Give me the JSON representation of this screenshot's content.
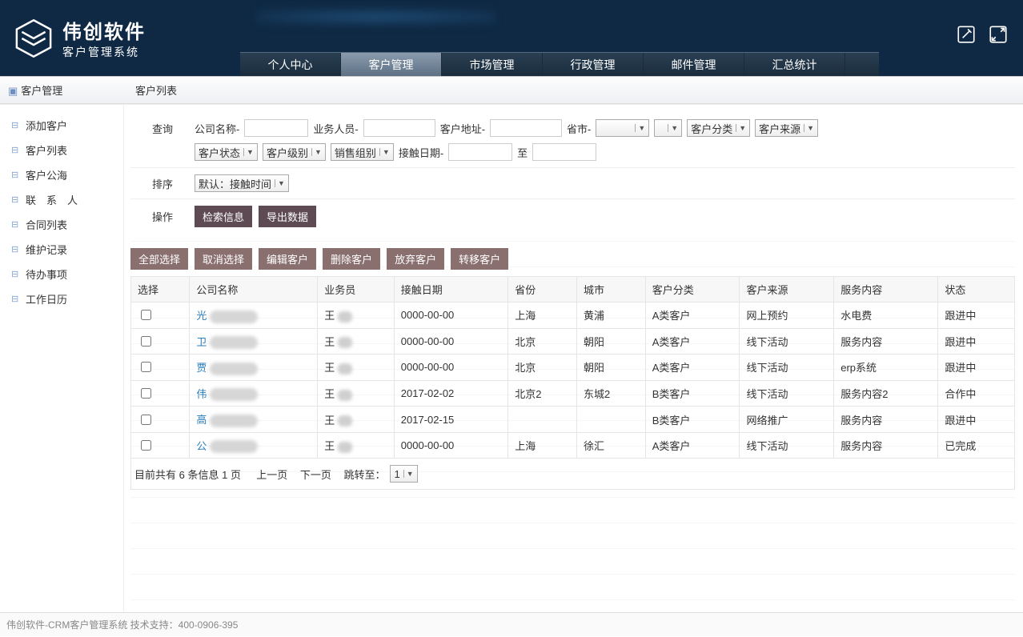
{
  "brand": {
    "name": "伟创软件",
    "sub": "客户管理系统"
  },
  "nav": [
    "个人中心",
    "客户管理",
    "市场管理",
    "行政管理",
    "邮件管理",
    "汇总统计"
  ],
  "nav_active_index": 1,
  "subheader": {
    "left": "客户管理",
    "title": "客户列表"
  },
  "sidebar": [
    "添加客户",
    "客户列表",
    "客户公海",
    "联　系　人",
    "合同列表",
    "维护记录",
    "待办事项",
    "工作日历"
  ],
  "search": {
    "section_label": "查询",
    "company_label": "公司名称-",
    "sales_label": "业务人员-",
    "address_label": "客户地址-",
    "province_label": "省市-",
    "category_label": "客户分类",
    "source_label": "客户来源",
    "status_label": "客户状态",
    "level_label": "客户级别",
    "salesgroup_label": "销售组别",
    "contact_date_label": "接触日期-",
    "to": "至"
  },
  "sort": {
    "label": "排序",
    "default": "默认：接触时间"
  },
  "ops": {
    "label": "操作",
    "search_btn": "检索信息",
    "export_btn": "导出数据"
  },
  "bulk_buttons": [
    "全部选择",
    "取消选择",
    "编辑客户",
    "删除客户",
    "放弃客户",
    "转移客户"
  ],
  "table": {
    "headers": [
      "选择",
      "公司名称",
      "业务员",
      "接触日期",
      "省份",
      "城市",
      "客户分类",
      "客户来源",
      "服务内容",
      "状态"
    ],
    "rows": [
      {
        "company": "光",
        "sales": "王",
        "date": "0000-00-00",
        "prov": "上海",
        "city": "黄浦",
        "cat": "A类客户",
        "src": "网上预约",
        "svc": "水电费",
        "status": "跟进中"
      },
      {
        "company": "卫",
        "sales": "王",
        "date": "0000-00-00",
        "prov": "北京",
        "city": "朝阳",
        "cat": "A类客户",
        "src": "线下活动",
        "svc": "服务内容",
        "status": "跟进中"
      },
      {
        "company": "贾",
        "sales": "王",
        "date": "0000-00-00",
        "prov": "北京",
        "city": "朝阳",
        "cat": "A类客户",
        "src": "线下活动",
        "svc": "erp系统",
        "status": "跟进中"
      },
      {
        "company": "伟",
        "sales": "王",
        "date": "2017-02-02",
        "prov": "北京2",
        "city": "东城2",
        "cat": "B类客户",
        "src": "线下活动",
        "svc": "服务内容2",
        "status": "合作中"
      },
      {
        "company": "高",
        "sales": "王",
        "date": "2017-02-15",
        "prov": "",
        "city": "",
        "cat": "B类客户",
        "src": "网络推广",
        "svc": "服务内容",
        "status": "跟进中"
      },
      {
        "company": "公",
        "sales": "王",
        "date": "0000-00-00",
        "prov": "上海",
        "city": "徐汇",
        "cat": "A类客户",
        "src": "线下活动",
        "svc": "服务内容",
        "status": "已完成"
      }
    ]
  },
  "pager": {
    "summary_prefix": "目前共有 ",
    "count": "6",
    "summary_mid": " 条信息  ",
    "pages": "1",
    "summary_suffix": " 页",
    "prev": "上一页",
    "next": "下一页",
    "jump": "跳转至：",
    "current": "1"
  },
  "footer": "伟创软件-CRM客户管理系统   技术支持：400-0906-395"
}
